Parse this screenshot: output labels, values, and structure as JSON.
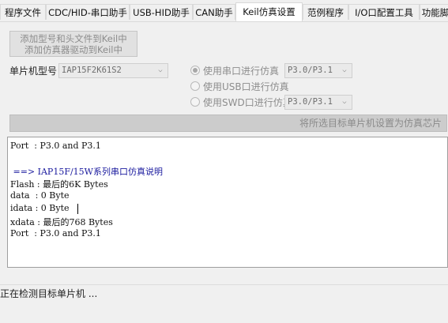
{
  "tabs": [
    {
      "label": "程序文件",
      "active": false
    },
    {
      "label": "CDC/HID-串口助手",
      "active": false
    },
    {
      "label": "USB-HID助手",
      "active": false
    },
    {
      "label": "CAN助手",
      "active": false
    },
    {
      "label": "Keil仿真设置",
      "active": true
    },
    {
      "label": "范例程序",
      "active": false
    },
    {
      "label": "I/O口配置工具",
      "active": false
    },
    {
      "label": "功能脚",
      "active": false
    }
  ],
  "keil": {
    "add_button_label": "添加型号和头文件到Keil中\n添加仿真器驱动到Keil中",
    "mcu_label": "单片机型号",
    "mcu_value": "IAP15F2K61S2",
    "options": [
      {
        "label": "使用串口进行仿真",
        "checked": true,
        "port": "P3.0/P3.1"
      },
      {
        "label": "使用USB口进行仿真",
        "checked": false,
        "port": ""
      },
      {
        "label": "使用SWD口进行仿真",
        "checked": false,
        "port": "P3.0/P3.1"
      }
    ],
    "set_chip_button": "将所选目标单片机设置为仿真芯片"
  },
  "log": {
    "lines": [
      "Port  : P3.0 and P3.1",
      "",
      " ==> IAP15F/15W系列串口仿真说明",
      "Flash : 最后的6K Bytes",
      "data  : 0 Byte",
      "idata : 0 Byte",
      "xdata : 最后的768 Bytes",
      "Port  : P3.0 and P3.1"
    ]
  },
  "status": {
    "text": "正在检测目标单片机 ..."
  },
  "colors": {
    "panel_bg": "#f0f0f0",
    "log_text_blue": "#1a1a9e",
    "disabled_text": "#8d8d8d"
  }
}
